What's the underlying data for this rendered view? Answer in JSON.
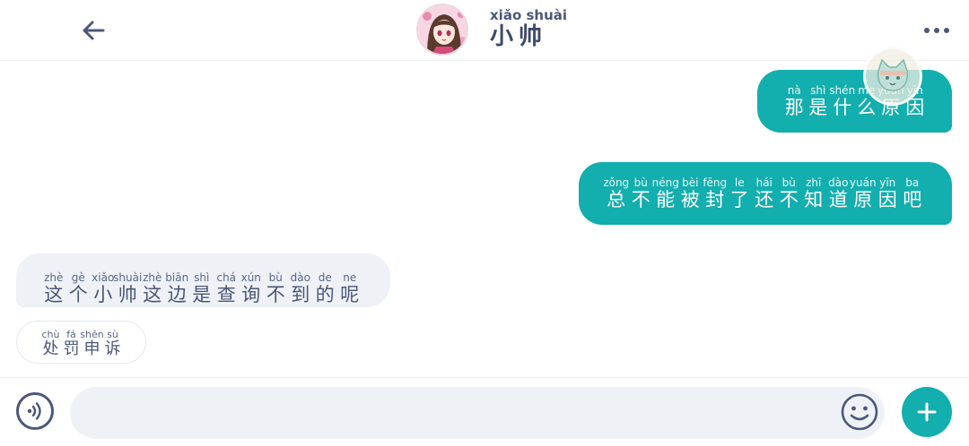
{
  "header": {
    "title_pinyin": "xiǎo shuài",
    "title": "小帅",
    "icons": {
      "back": "back-arrow-icon",
      "more": "more-dots-icon",
      "avatar": "avatar"
    }
  },
  "messages": [
    {
      "direction": "outgoing",
      "chars": [
        {
          "py": "nà",
          "hz": "那"
        },
        {
          "py": "shì",
          "hz": "是"
        },
        {
          "py": "shén",
          "hz": "什"
        },
        {
          "py": "me",
          "hz": "么"
        },
        {
          "py": "yuán",
          "hz": "原"
        },
        {
          "py": "yīn",
          "hz": "因"
        }
      ]
    },
    {
      "direction": "outgoing",
      "chars": [
        {
          "py": "zǒng",
          "hz": "总"
        },
        {
          "py": "bù",
          "hz": "不"
        },
        {
          "py": "néng",
          "hz": "能"
        },
        {
          "py": "bèi",
          "hz": "被"
        },
        {
          "py": "fēng",
          "hz": "封"
        },
        {
          "py": "le",
          "hz": "了"
        },
        {
          "py": "hái",
          "hz": "还"
        },
        {
          "py": "bù",
          "hz": "不"
        },
        {
          "py": "zhī",
          "hz": "知"
        },
        {
          "py": "dào",
          "hz": "道"
        },
        {
          "py": "yuán",
          "hz": "原"
        },
        {
          "py": "yīn",
          "hz": "因"
        },
        {
          "py": "ba",
          "hz": "吧"
        }
      ]
    },
    {
      "direction": "incoming",
      "chars": [
        {
          "py": "zhè",
          "hz": "这"
        },
        {
          "py": "gè",
          "hz": "个"
        },
        {
          "py": "xiǎo",
          "hz": "小"
        },
        {
          "py": "shuài",
          "hz": "帅"
        },
        {
          "py": "zhè",
          "hz": "这"
        },
        {
          "py": "biān",
          "hz": "边"
        },
        {
          "py": "shì",
          "hz": "是"
        },
        {
          "py": "chá",
          "hz": "查"
        },
        {
          "py": "xún",
          "hz": "询"
        },
        {
          "py": "bù",
          "hz": "不"
        },
        {
          "py": "dào",
          "hz": "到"
        },
        {
          "py": "de",
          "hz": "的"
        },
        {
          "py": "ne",
          "hz": "呢"
        }
      ]
    }
  ],
  "quick_reply": {
    "chars": [
      {
        "py": "chù",
        "hz": "处"
      },
      {
        "py": "fá",
        "hz": "罚"
      },
      {
        "py": "shēn",
        "hz": "申"
      },
      {
        "py": "sù",
        "hz": "诉"
      }
    ]
  },
  "composer": {
    "value": "",
    "placeholder": "",
    "icons": {
      "voice": "voice-icon",
      "emoji": "emoji-icon",
      "add": "plus-icon"
    }
  },
  "colors": {
    "accent": "#13aeae",
    "incoming_bubble": "#eef2f7",
    "text": "#3b4a6b"
  }
}
